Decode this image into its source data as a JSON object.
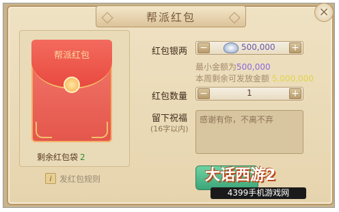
{
  "dialog": {
    "title": "帮派红包",
    "close_icon": "close-icon"
  },
  "envelope": {
    "label": "帮派红包"
  },
  "remaining": {
    "label": "剩余红包袋",
    "count": "2"
  },
  "rules": {
    "label": "发红包规则",
    "icon": "info-icon"
  },
  "silver": {
    "label": "红包银两",
    "value": "500,000",
    "minus": "−",
    "plus": "+"
  },
  "hints": {
    "min_prefix": "最小金额为",
    "min_value": "500,000",
    "week_prefix": "本周剩余可发放金额",
    "week_value": "5,000,000"
  },
  "quantity": {
    "label": "红包数量",
    "value": "1",
    "minus": "−",
    "plus": "+"
  },
  "blessing": {
    "label": "留下祝福",
    "sub_label": "(16字以内)",
    "value": "感谢有你，不离不弃"
  },
  "watermark": {
    "title": "大话西游2",
    "strip": "4399手机游戏网"
  },
  "colors": {
    "accent_purple": "#8b67e0",
    "remaining_green": "#2f8a2f",
    "envelope_red": "#e4564c"
  }
}
